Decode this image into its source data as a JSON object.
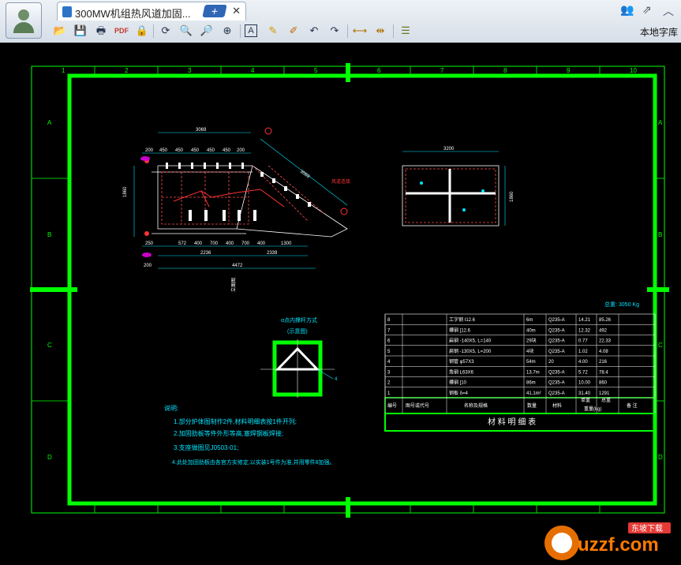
{
  "tab": {
    "title": "300MW机组热风道加固...",
    "close_glyph": "✕",
    "new_glyph": "+"
  },
  "toolbar": {
    "font_library": "本地字库",
    "text_tool_glyph": "A"
  },
  "drawing": {
    "grid_cols": [
      "1",
      "2",
      "3",
      "4",
      "5",
      "6",
      "7",
      "8",
      "9",
      "10"
    ],
    "grid_rows": [
      "A",
      "B",
      "C",
      "D"
    ],
    "dims_top": {
      "overall": "3069",
      "segs": [
        "200",
        "450",
        "450",
        "450",
        "450",
        "450",
        "200"
      ]
    },
    "dims_bottom": {
      "segs": [
        "572",
        "400",
        "700",
        "400",
        "700",
        "400"
      ],
      "d2236": "2236",
      "d2339": "2339",
      "d1300": "1300",
      "overall": "4472",
      "left": "200",
      "d250": "250"
    },
    "dims_left": {
      "d1860": "1860"
    },
    "right_view": {
      "width": "3200",
      "height": "1860"
    },
    "detail": {
      "title": "α点内撑杆方式",
      "subtitle": "(示意图)",
      "label": "4"
    },
    "weight": "总重: 3050 Kg",
    "table": {
      "caption": "材 料 明 细 表",
      "headers": [
        "编号",
        "图号或代号",
        "名称及规格",
        "数量",
        "材料",
        "单重",
        "总重",
        "备 注"
      ],
      "unit_header": "重量(kg)",
      "rows": [
        [
          "8",
          "",
          "工字钢 I12.6",
          "6m",
          "Q235-A",
          "14.21",
          "85.26",
          ""
        ],
        [
          "7",
          "",
          "槽钢 [12.6",
          "40m",
          "Q235-A",
          "12.32",
          "492",
          ""
        ],
        [
          "6",
          "",
          "扁钢 -140X5, L=140",
          "29块",
          "Q235-A",
          "0.77",
          "22.33",
          ""
        ],
        [
          "5",
          "",
          "扁钢 -130X5, L=200",
          "4块",
          "Q235-A",
          "1.02",
          "4.08",
          ""
        ],
        [
          "4",
          "",
          "钢管 φ57X3",
          "54m",
          "20",
          "4.00",
          "216",
          ""
        ],
        [
          "3",
          "",
          "角钢 L63X6",
          "13.7m",
          "Q235-A",
          "5.72",
          "78.4",
          ""
        ],
        [
          "2",
          "",
          "槽钢 [10",
          "86m",
          "Q235-A",
          "10.00",
          "860",
          ""
        ],
        [
          "1",
          "",
          "钢板 δ=4",
          "41.1m²",
          "Q235-A",
          "31.40",
          "1291",
          ""
        ]
      ]
    },
    "notes": {
      "title": "说明:",
      "items": [
        "1.部分炉体图制作2件,材料明细表按1件开列;",
        "2.加固肋板等件外形等高,塞焊钢板焊接;",
        "3.支座做图见J0503-01;",
        "4.此处加固肋板由各官方实修定,以实装1号件为准,并用零件8加强。"
      ]
    },
    "flag_label": "风道连接",
    "side_label": "立面图"
  },
  "watermark": {
    "brand": "uzzf.com",
    "site": "东坡下载"
  },
  "colors": {
    "frame": "#00ff00",
    "dimension": "#00e5ff",
    "annotation": "#ff3333",
    "text": "#ffffff",
    "hidden": "#ff4d4d"
  }
}
